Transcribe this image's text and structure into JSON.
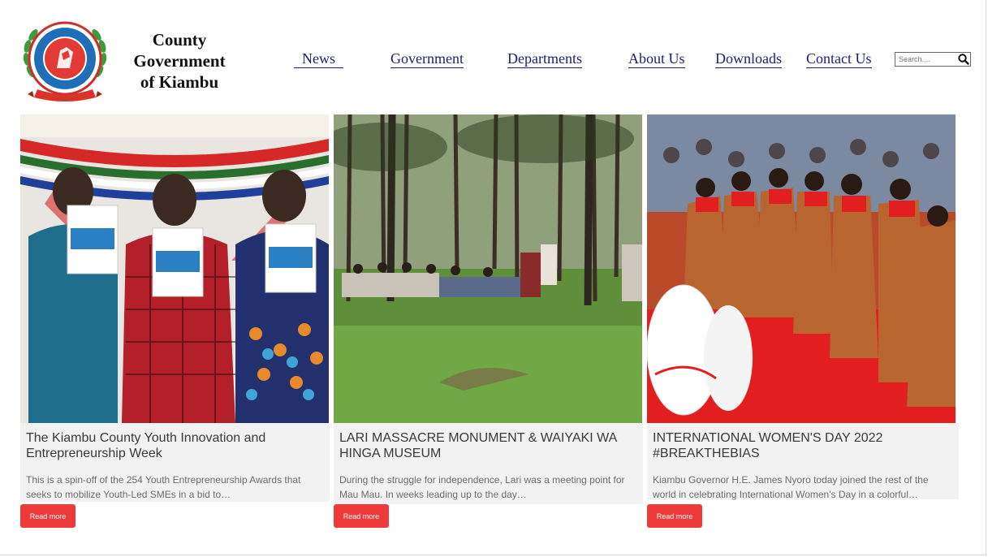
{
  "brand": {
    "line1": "County",
    "line2": "Government",
    "line3": "of Kiambu",
    "logo_icon": "county-seal-icon",
    "seal_text_top": "COUNTY GOVERNMENT OF KIAMBU",
    "seal_text_bottom": "UMOJA NA MAENDELEO"
  },
  "nav": {
    "items": [
      {
        "label": "News"
      },
      {
        "label": "Government"
      },
      {
        "label": "Departments"
      },
      {
        "label": "About Us"
      },
      {
        "label": "Downloads"
      },
      {
        "label": "Contact Us"
      }
    ]
  },
  "search": {
    "placeholder": "Search....",
    "icon": "search-icon"
  },
  "colors": {
    "nav_link": "#1b1d7a",
    "button_bg": "#ef3a3a",
    "card_bg": "#f2f2f2"
  },
  "cards": [
    {
      "title": "The Kiambu County Youth Innovation and Entrepreneurship Week",
      "excerpt": "This is a spin-off of the 254 Youth Entrepreneurship Awards that seeks to mobilize Youth-Led SMEs in a bid to…",
      "button": "Read more",
      "image": "photo-officials-holding-directory"
    },
    {
      "title": "LARI MASSACRE MONUMENT & WAIYAKI WA HINGA MUSEUM",
      "excerpt": "During the struggle for independence, Lari was a meeting point for Mau Mau. In weeks leading up to the day…",
      "button": "Read more",
      "image": "photo-forest-gathering"
    },
    {
      "title": "INTERNATIONAL WOMEN'S DAY 2022 #BREAKTHEBIAS",
      "excerpt": "Kiambu Governor H.E. James Nyoro today joined the rest of the world in celebrating International Women's Day in a colorful…",
      "button": "Read more",
      "image": "photo-womens-day-dancers"
    }
  ]
}
